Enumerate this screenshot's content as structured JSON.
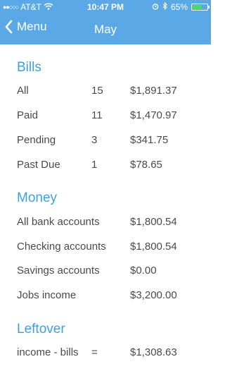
{
  "status": {
    "signal_dots": "●●○○○",
    "carrier": "AT&T",
    "time": "10:47 PM",
    "battery": "65%",
    "battery_level": 0.65
  },
  "nav": {
    "back_label": "Menu",
    "title": "May"
  },
  "bills": {
    "title": "Bills",
    "rows": [
      {
        "label": "All",
        "count": "15",
        "amount": "$1,891.37"
      },
      {
        "label": "Paid",
        "count": "11",
        "amount": "$1,470.97"
      },
      {
        "label": "Pending",
        "count": "3",
        "amount": "$341.75"
      },
      {
        "label": "Past Due",
        "count": "1",
        "amount": "$78.65"
      }
    ]
  },
  "money": {
    "title": "Money",
    "rows": [
      {
        "label": "All bank accounts",
        "amount": "$1,800.54"
      },
      {
        "label": "Checking accounts",
        "amount": "$1,800.54"
      },
      {
        "label": "Savings accounts",
        "amount": "$0.00"
      },
      {
        "label": "Jobs income",
        "amount": "$3,200.00"
      }
    ]
  },
  "leftover": {
    "title": "Leftover",
    "label": "income - bills",
    "operator": "=",
    "amount": "$1,308.63"
  }
}
